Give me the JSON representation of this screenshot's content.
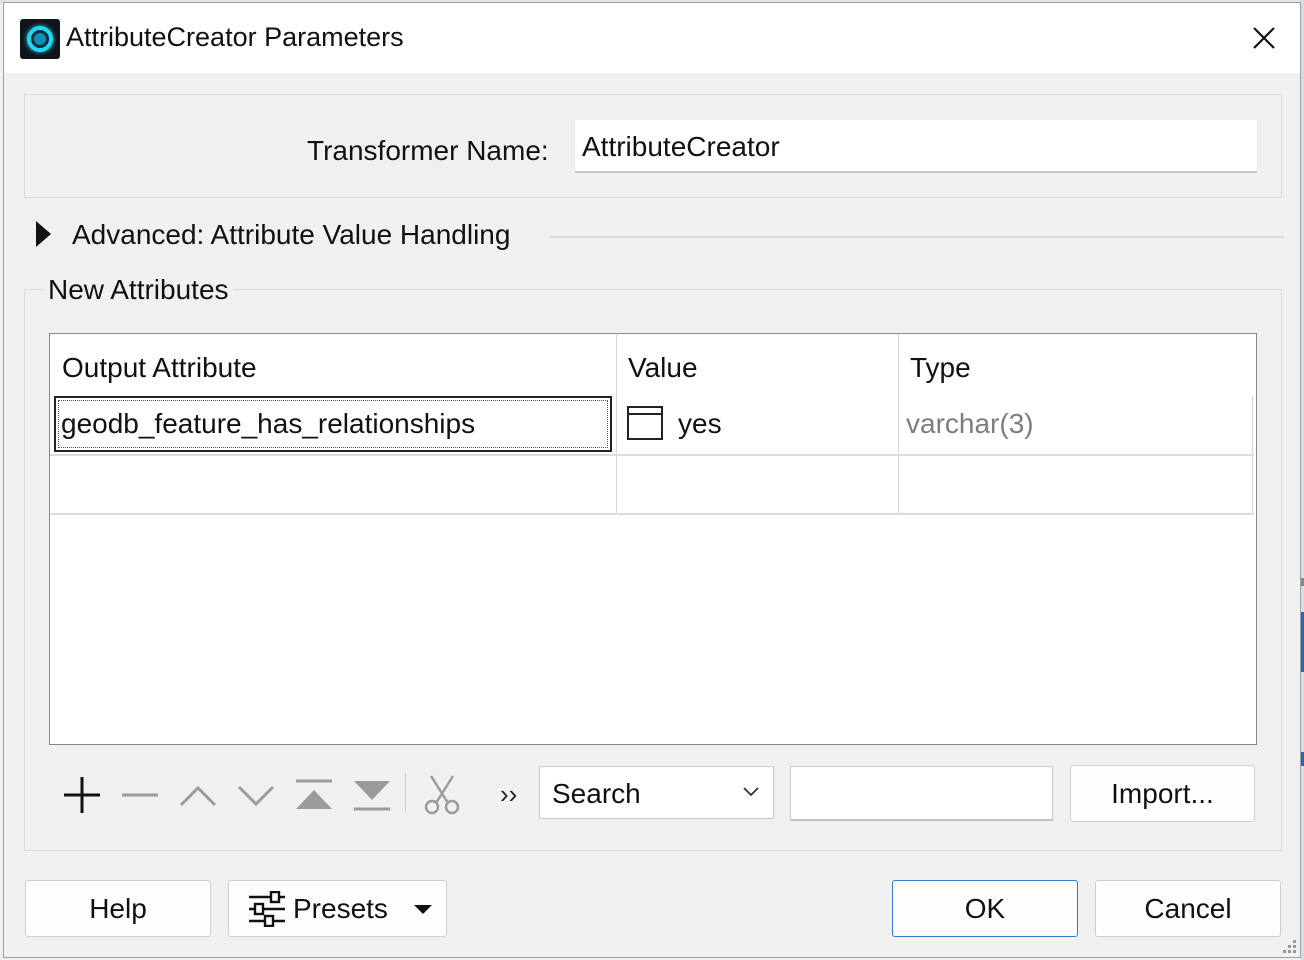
{
  "window": {
    "title": "AttributeCreator Parameters",
    "icon": "fme-app-icon",
    "close_icon": "close-icon"
  },
  "transformer": {
    "label": "Transformer Name:",
    "value": "AttributeCreator"
  },
  "advanced": {
    "label": "Advanced: Attribute Value Handling",
    "expanded": false
  },
  "new_attributes": {
    "title": "New Attributes",
    "columns": [
      "Output Attribute",
      "Value",
      "Type"
    ],
    "rows": [
      {
        "output": "geodb_feature_has_relationships",
        "value": "yes",
        "type": "varchar(3)"
      },
      {
        "output": "",
        "value": "",
        "type": ""
      }
    ]
  },
  "toolbar": {
    "icons": [
      "add-icon",
      "remove-icon",
      "move-up-icon",
      "move-down-icon",
      "move-top-icon",
      "move-bottom-icon",
      "cut-icon"
    ],
    "more": "››",
    "search_select": "Search",
    "search_value": "",
    "import_label": "Import..."
  },
  "footer": {
    "help_label": "Help",
    "presets_label": "Presets",
    "ok_label": "OK",
    "cancel_label": "Cancel"
  },
  "colors": {
    "accent": "#3b78c9",
    "icon_ring": "#22d6f0",
    "type_text": "#7d7d7d"
  }
}
